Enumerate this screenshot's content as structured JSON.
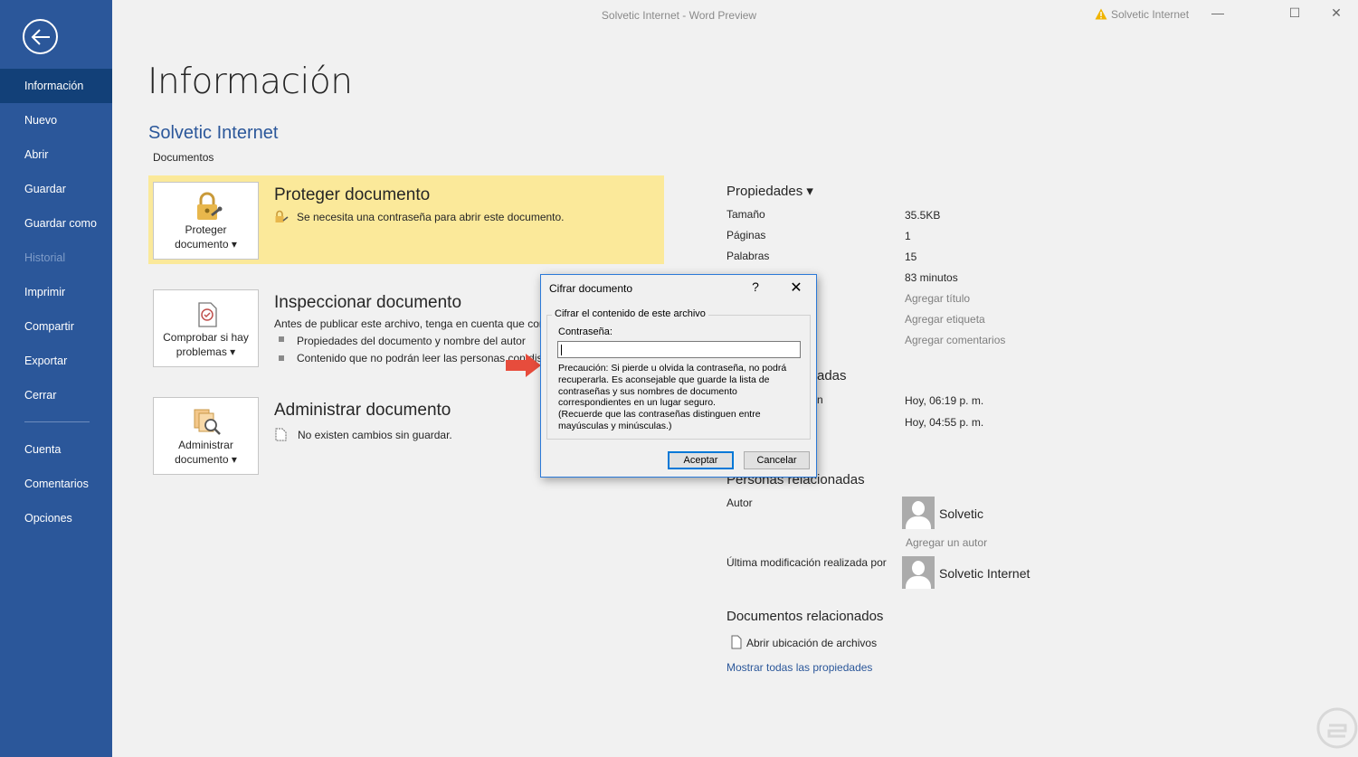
{
  "window": {
    "title": "Solvetic Internet  -  Word Preview",
    "user": "Solvetic Internet",
    "minimize": "—",
    "maximize": "☐",
    "close": "✕"
  },
  "sidebar": {
    "items": [
      {
        "label": "Información",
        "state": "active"
      },
      {
        "label": "Nuevo"
      },
      {
        "label": "Abrir"
      },
      {
        "label": "Guardar"
      },
      {
        "label": "Guardar como"
      },
      {
        "label": "Historial",
        "state": "disabled"
      },
      {
        "label": "Imprimir"
      },
      {
        "label": "Compartir"
      },
      {
        "label": "Exportar"
      },
      {
        "label": "Cerrar"
      },
      {
        "label": "Cuenta"
      },
      {
        "label": "Comentarios"
      },
      {
        "label": "Opciones"
      }
    ]
  },
  "main": {
    "title": "Información",
    "doc_name": "Solvetic Internet",
    "doc_path": "Documentos",
    "protect": {
      "button_line1": "Proteger",
      "button_line2": "documento ▾",
      "title": "Proteger documento",
      "text": "Se necesita una contraseña para abrir este documento."
    },
    "inspect": {
      "button_line1": "Comprobar si hay",
      "button_line2": "problemas ▾",
      "title": "Inspeccionar documento",
      "text": "Antes de publicar este archivo, tenga en cuenta que con",
      "bullets": [
        "Propiedades del documento y nombre del autor",
        "Contenido que no podrán leer las personas con dis"
      ]
    },
    "manage": {
      "button_line1": "Administrar",
      "button_line2": "documento ▾",
      "title": "Administrar documento",
      "text": "No existen cambios sin guardar."
    }
  },
  "properties": {
    "heading": "Propiedades ▾",
    "rows": [
      {
        "label": "Tamaño",
        "value": "35.5KB"
      },
      {
        "label": "Páginas",
        "value": "1"
      },
      {
        "label": "Palabras",
        "value": "15"
      },
      {
        "label": "",
        "value": "83 minutos"
      },
      {
        "label": "",
        "value": "Agregar título"
      },
      {
        "label": "",
        "value": "Agregar etiqueta"
      },
      {
        "label": "",
        "value": "Agregar comentarios"
      }
    ],
    "dates_heading": "adas",
    "dates": [
      {
        "label": "n",
        "value": "Hoy, 06:19 p. m."
      },
      {
        "label": "",
        "value": "Hoy, 04:55 p. m."
      }
    ],
    "people_heading": "Personas relacionadas",
    "author_label": "Autor",
    "author_name": "Solvetic",
    "add_author": "Agregar un autor",
    "modified_label": "Última modificación realizada por",
    "modified_name": "Solvetic Internet",
    "related_heading": "Documentos relacionados",
    "open_location": "Abrir ubicación de archivos",
    "show_all": "Mostrar todas las propiedades"
  },
  "dialog": {
    "title": "Cifrar documento",
    "help": "?",
    "close": "✕",
    "group_legend": "Cifrar el contenido de este archivo",
    "password_label": "Contraseña:",
    "password_value": "",
    "warning": "Precaución: Si pierde u olvida la contraseña, no podrá recuperarla. Es aconsejable que guarde la lista de contraseñas y sus nombres de documento correspondientes en un lugar seguro.\n(Recuerde que las contraseñas distinguen entre mayúsculas y minúsculas.)",
    "ok": "Aceptar",
    "cancel": "Cancelar"
  },
  "colors": {
    "sidebar": "#2b579a",
    "sidebar_active": "#124078",
    "protect_bg": "#fbe99a",
    "accent_text": "#2b579a",
    "annotation_arrow": "#e74c3c"
  }
}
